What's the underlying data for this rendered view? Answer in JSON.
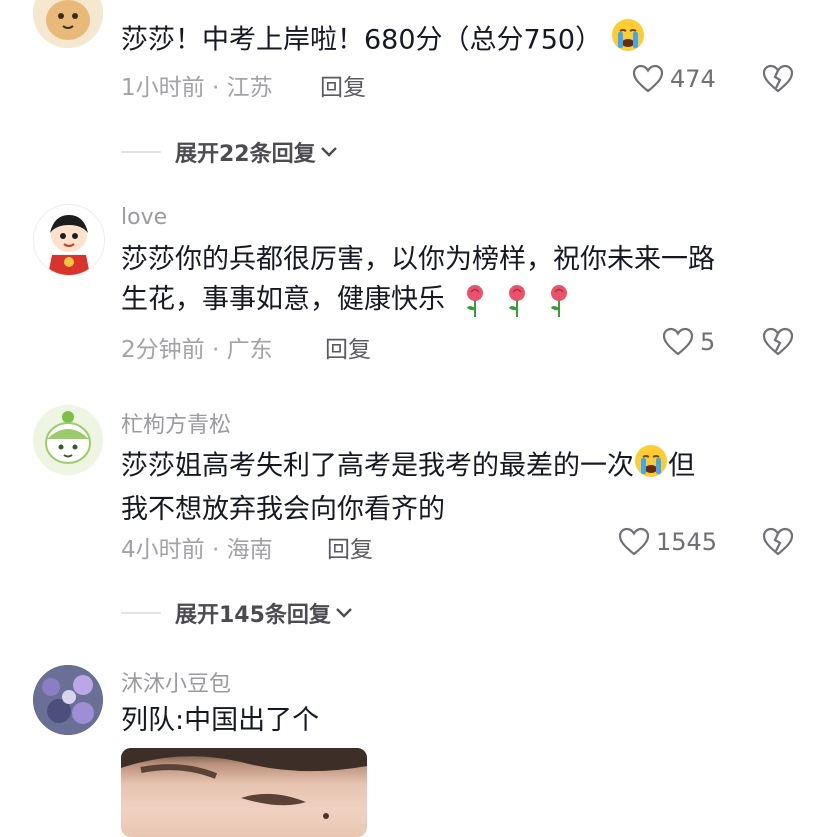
{
  "comments": [
    {
      "username": "",
      "text": "莎莎！中考上岸啦！680分（总分750）",
      "meta": "1小时前 · 江苏",
      "reply": "回复",
      "likes": "474",
      "expand": "展开22条回复"
    },
    {
      "username": "love",
      "text_line1": "莎莎你的兵都很厉害，以你为榜样，祝你未来一路",
      "text_line2": "生花，事事如意，健康快乐",
      "meta": "2分钟前 · 广东",
      "reply": "回复",
      "likes": "5"
    },
    {
      "username": "杧枸方青松",
      "text_line1": "莎莎姐高考失利了高考是我考的最差的一次",
      "text_line1_tail": "但",
      "text_line2": "我不想放弃我会向你看齐的",
      "meta": "4小时前 · 海南",
      "reply": "回复",
      "likes": "1545",
      "expand": "展开145条回复"
    },
    {
      "username": "沐沐小豆包",
      "text": "列队:中国出了个"
    }
  ],
  "icons": {
    "like": "heart-outline-icon",
    "dislike": "broken-heart-icon",
    "expand": "chevron-down-icon",
    "emoji_crying": "crying-face-emoji",
    "rose": "rose-emoji"
  }
}
